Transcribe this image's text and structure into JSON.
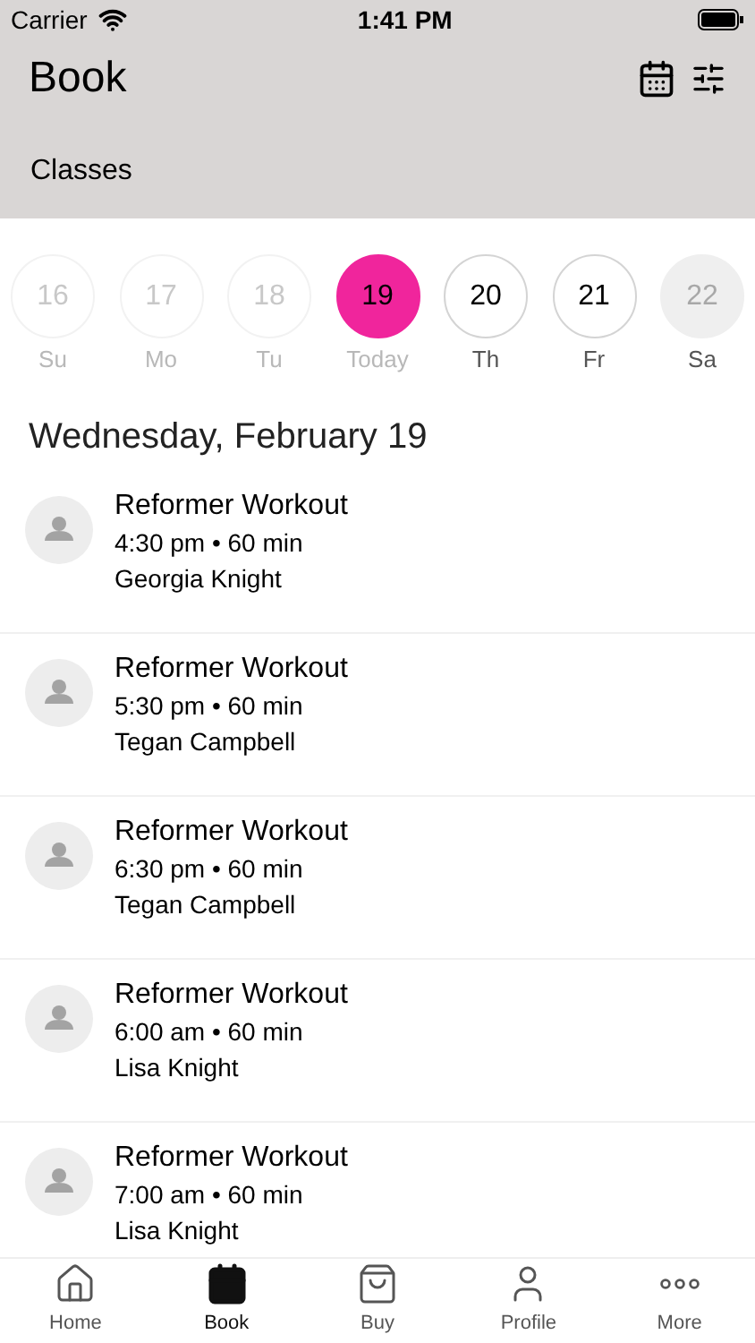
{
  "status_bar": {
    "carrier": "Carrier",
    "time": "1:41 PM"
  },
  "header": {
    "title": "Book",
    "subtitle": "Classes"
  },
  "days": [
    {
      "number": "16",
      "label": "Su",
      "kind": "past",
      "selected": false
    },
    {
      "number": "17",
      "label": "Mo",
      "kind": "past",
      "selected": false
    },
    {
      "number": "18",
      "label": "Tu",
      "kind": "past",
      "selected": false
    },
    {
      "number": "19",
      "label": "Today",
      "kind": "past",
      "selected": true
    },
    {
      "number": "20",
      "label": "Th",
      "kind": "open",
      "selected": false
    },
    {
      "number": "21",
      "label": "Fr",
      "kind": "open",
      "selected": false
    },
    {
      "number": "22",
      "label": "Sa",
      "kind": "closed",
      "selected": false
    }
  ],
  "date_heading": "Wednesday, February 19",
  "classes": [
    {
      "name": "Reformer Workout",
      "time": "4:30 pm • 60 min",
      "instructor": "Georgia Knight"
    },
    {
      "name": "Reformer Workout",
      "time": "5:30 pm • 60 min",
      "instructor": "Tegan Campbell"
    },
    {
      "name": "Reformer Workout",
      "time": "6:30 pm • 60 min",
      "instructor": "Tegan Campbell"
    },
    {
      "name": "Reformer Workout",
      "time": "6:00 am • 60 min",
      "instructor": "Lisa Knight"
    },
    {
      "name": "Reformer Workout",
      "time": "7:00 am • 60 min",
      "instructor": "Lisa Knight"
    }
  ],
  "tabs": [
    {
      "label": "Home",
      "kind": "home",
      "selected": false
    },
    {
      "label": "Book",
      "kind": "book",
      "selected": true
    },
    {
      "label": "Buy",
      "kind": "buy",
      "selected": false
    },
    {
      "label": "Profile",
      "kind": "profile",
      "selected": false
    },
    {
      "label": "More",
      "kind": "more",
      "selected": false
    }
  ]
}
